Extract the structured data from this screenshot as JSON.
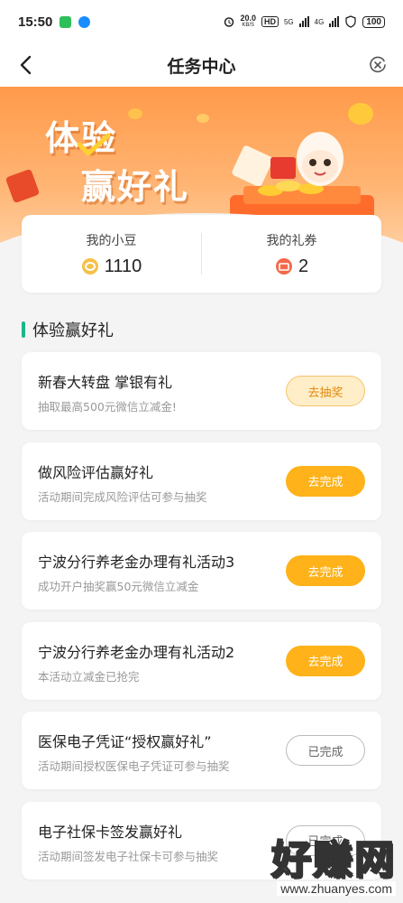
{
  "status_bar": {
    "time": "15:50",
    "speed": "20.0",
    "speed_unit": "KB/S",
    "hd": "HD",
    "net1": "5G",
    "net2": "4G",
    "battery": "100"
  },
  "navbar": {
    "title": "任务中心"
  },
  "banner": {
    "line1": "体验",
    "line2": "赢好礼"
  },
  "summary": {
    "beans_label": "我的小豆",
    "beans_value": "1110",
    "coupons_label": "我的礼券",
    "coupons_value": "2"
  },
  "section": {
    "title": "体验赢好礼"
  },
  "tasks": [
    {
      "title": "新春大转盘 掌银有礼",
      "desc": "抽取最高500元微信立减金!",
      "button": "去抽奖",
      "style": "draw"
    },
    {
      "title": "做风险评估赢好礼",
      "desc": "活动期间完成风险评估可参与抽奖",
      "button": "去完成",
      "style": "go"
    },
    {
      "title": "宁波分行养老金办理有礼活动3",
      "desc": "成功开户抽奖赢50元微信立减金",
      "button": "去完成",
      "style": "go"
    },
    {
      "title": "宁波分行养老金办理有礼活动2",
      "desc": "本活动立减金已抢完",
      "button": "去完成",
      "style": "go"
    },
    {
      "title": "医保电子凭证“授权赢好礼”",
      "desc": "活动期间授权医保电子凭证可参与抽奖",
      "button": "已完成",
      "style": "done"
    },
    {
      "title": "电子社保卡签发赢好礼",
      "desc": "活动期间签发电子社保卡可参与抽奖",
      "button": "已完成",
      "style": "done"
    }
  ],
  "watermark": {
    "text": "好赚网",
    "url": "www.zhuanyes.com"
  },
  "colors": {
    "accent_orange": "#ffb219",
    "section_green": "#1bb58a",
    "banner_orange": "#ff9a4a"
  }
}
